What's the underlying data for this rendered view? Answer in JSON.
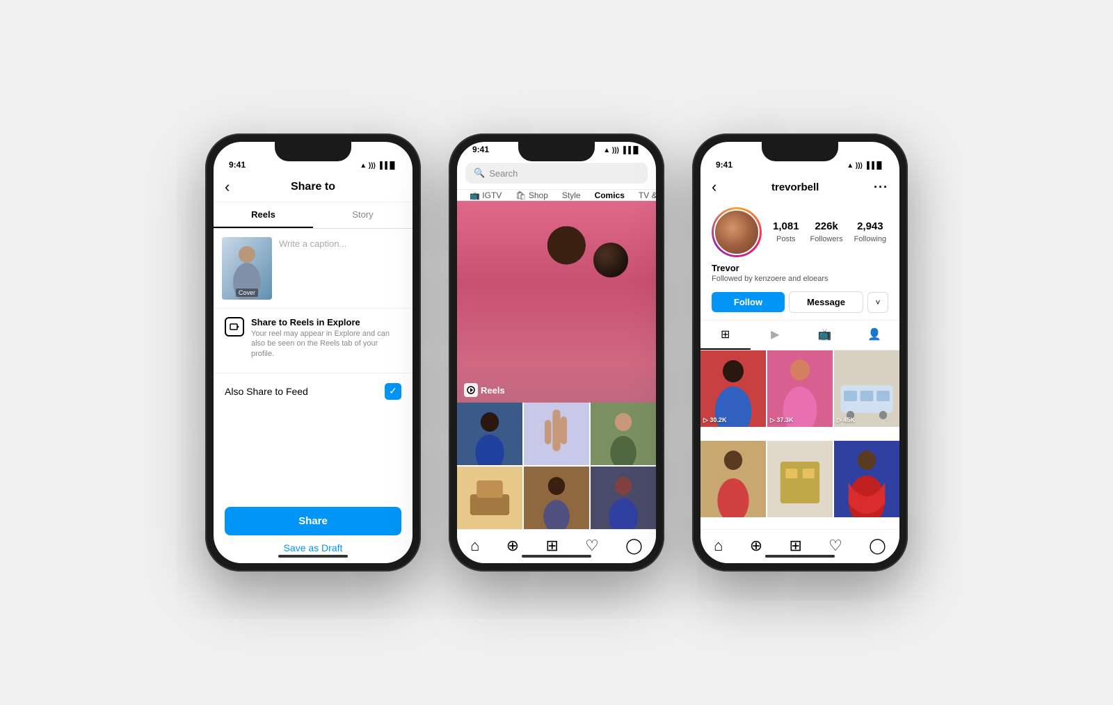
{
  "scene": {
    "bg": "#f0f0f0"
  },
  "phone1": {
    "status_time": "9:41",
    "nav_back": "‹",
    "nav_title": "Share to",
    "tab_reels": "Reels",
    "tab_story": "Story",
    "cover_label": "Cover",
    "caption_placeholder": "Write a caption...",
    "option_title": "Share to Reels in Explore",
    "option_desc": "Your reel may appear in Explore and can also be seen on the Reels tab of your profile.",
    "also_share_label": "Also Share to Feed",
    "share_btn": "Share",
    "draft_btn": "Save as Draft"
  },
  "phone2": {
    "status_time": "9:41",
    "search_placeholder": "Search",
    "categories": [
      "IGTV",
      "Shop",
      "Style",
      "Comics",
      "TV & Movie"
    ],
    "reels_label": "Reels",
    "thumb_counts": [
      "",
      "",
      "",
      "",
      "",
      ""
    ]
  },
  "phone3": {
    "status_time": "9:41",
    "back": "‹",
    "username": "trevorbell",
    "dots": "···",
    "posts_count": "1,081",
    "posts_label": "Posts",
    "followers_count": "226k",
    "followers_label": "Followers",
    "following_count": "2,943",
    "following_label": "Following",
    "bio_name": "Trevor",
    "bio_follow": "Followed by kenzoere and eloears",
    "follow_btn": "Follow",
    "message_btn": "Message",
    "dropdown": "˅",
    "view_counts": [
      "30.2K",
      "37.3K",
      "45K",
      "",
      "",
      ""
    ]
  }
}
